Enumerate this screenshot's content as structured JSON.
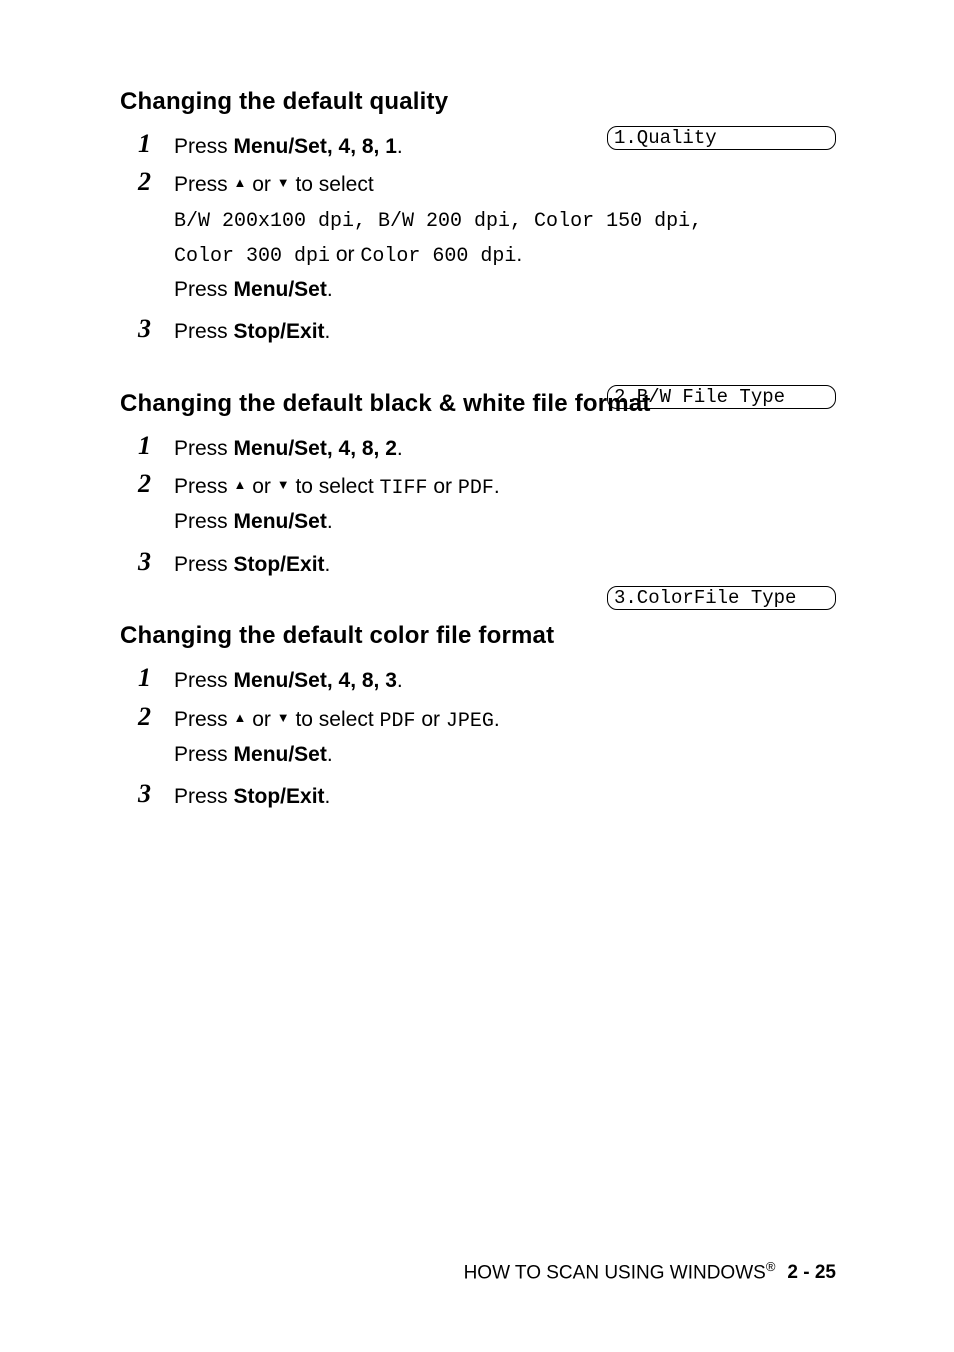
{
  "sections": [
    {
      "title": "Changing the default quality",
      "lcd": "1.Quality",
      "steps": {
        "s1": {
          "num": "1",
          "press": "Press ",
          "key": "Menu/Set",
          "seq": ", 4, 8, 1",
          "end": "."
        },
        "s2": {
          "num": "2",
          "line1a": "Press ",
          "line1b": " or ",
          "line1c": " to select ",
          "opts_line1": "B/W 200x100 dpi, B/W 200 dpi, Color 150 dpi,",
          "opts_line2a": "Color 300 dpi",
          "opts_line2b": " or ",
          "opts_line2c": "Color 600 dpi",
          "opts_line2d": ".",
          "press2a": "Press ",
          "press2b": "Menu/Set",
          "press2c": "."
        },
        "s3": {
          "num": "3",
          "press": "Press ",
          "key": "Stop/Exit",
          "end": "."
        }
      }
    },
    {
      "title": "Changing the default black & white file format",
      "lcd": "2.B/W File Type",
      "steps": {
        "s1": {
          "num": "1",
          "press": "Press ",
          "key": "Menu/Set",
          "seq": ", 4, 8, 2",
          "end": "."
        },
        "s2": {
          "num": "2",
          "line1a": "Press ",
          "line1b": " or ",
          "line1c": " to select ",
          "opt1": "TIFF",
          "line1d": " or ",
          "opt2": "PDF",
          "line1e": ".",
          "press2a": "Press ",
          "press2b": "Menu/Set",
          "press2c": "."
        },
        "s3": {
          "num": "3",
          "press": "Press ",
          "key": "Stop/Exit",
          "end": "."
        }
      }
    },
    {
      "title": "Changing the default color file format",
      "lcd": "3.ColorFile Type",
      "steps": {
        "s1": {
          "num": "1",
          "press": "Press ",
          "key": "Menu/Set",
          "seq": ", 4, 8, 3",
          "end": "."
        },
        "s2": {
          "num": "2",
          "line1a": "Press ",
          "line1b": " or ",
          "line1c": " to select ",
          "opt1": "PDF",
          "line1d": " or ",
          "opt2": "JPEG",
          "line1e": ".",
          "press2a": "Press ",
          "press2b": "Menu/Set",
          "press2c": "."
        },
        "s3": {
          "num": "3",
          "press": "Press ",
          "key": "Stop/Exit",
          "end": "."
        }
      }
    }
  ],
  "footer": {
    "text": "HOW TO SCAN USING WINDOWS",
    "reg": "®",
    "page": "2 - 25"
  }
}
